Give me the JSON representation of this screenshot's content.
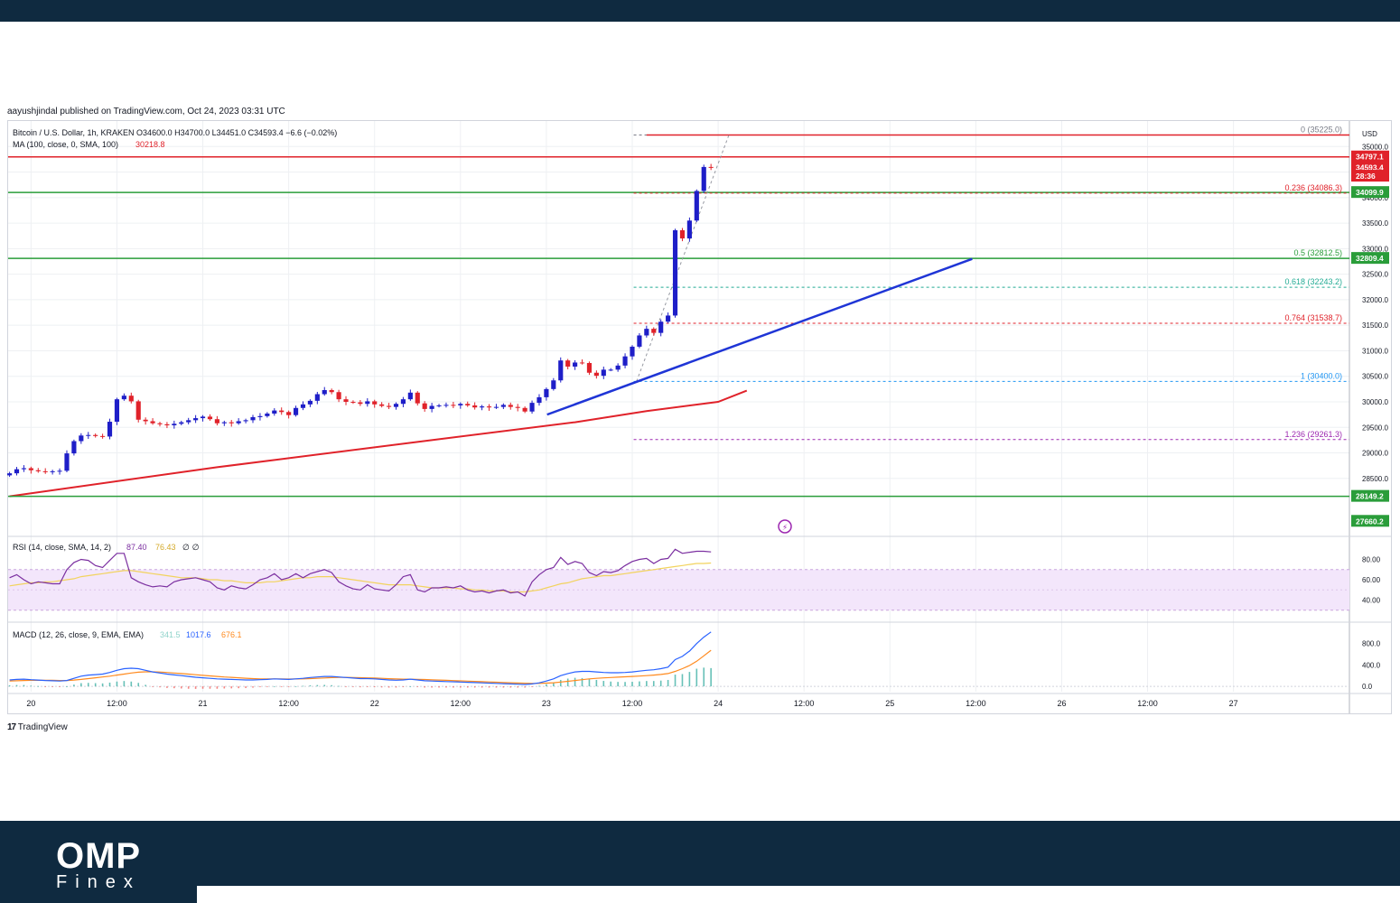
{
  "header": {
    "published": "aayushjindal published on TradingView.com, Oct 24, 2023 03:31 UTC"
  },
  "footer": {
    "brand_main": "OMP",
    "brand_sub": "Finex",
    "tv_brand": "TradingView",
    "tv_logo_mark": "17"
  },
  "legend": {
    "symbol": "Bitcoin / U.S. Dollar, 1h, KRAKEN",
    "ohlc": "O34600.0  H34700.0  L34451.0  C34593.4  −6.6 (−0.02%)",
    "ma_label": "MA (100, close, 0, SMA, 100)",
    "ma_value": "30218.8",
    "rsi_label": "RSI (14, close, SMA, 14, 2)",
    "rsi_value": "87.40",
    "rsi_ma": "76.43",
    "rsi_extra": "∅  ∅",
    "macd_label": "MACD (12, 26, close, 9, EMA, EMA)",
    "macd_hist": "341.5",
    "macd_line": "1017.6",
    "macd_signal": "676.1"
  },
  "colors": {
    "bull": "#1e1ec8",
    "bear": "#e0222a",
    "resistance": "#e0222a",
    "support": "#2a9d3a",
    "trendline": "#1f35d6",
    "ma": "#e0222a",
    "rsi": "#7b2fa0",
    "rsi_ma": "#f2d35e",
    "macd": "#2962ff",
    "signal": "#ff8a1e"
  },
  "chart_data": {
    "type": "candlestick",
    "title": "Bitcoin / U.S. Dollar, 1h, KRAKEN",
    "currency": "USD",
    "ylim": [
      27400,
      35500
    ],
    "y_ticks": [
      {
        "value": 35000,
        "label": "35000.0"
      },
      {
        "value": 34500,
        "label": "34500.0"
      },
      {
        "value": 34000,
        "label": "34000.0"
      },
      {
        "value": 33500,
        "label": "33500.0"
      },
      {
        "value": 33000,
        "label": "33000.0"
      },
      {
        "value": 32500,
        "label": "32500.0"
      },
      {
        "value": 32000,
        "label": "32000.0"
      },
      {
        "value": 31500,
        "label": "31500.0"
      },
      {
        "value": 31000,
        "label": "31000.0"
      },
      {
        "value": 30500,
        "label": "30500.0"
      },
      {
        "value": 30000,
        "label": "30000.0"
      },
      {
        "value": 29500,
        "label": "29500.0"
      },
      {
        "value": 29000,
        "label": "29000.0"
      },
      {
        "value": 28500,
        "label": "28500.0"
      }
    ],
    "x_ticks": [
      {
        "hour": 24,
        "label": "20"
      },
      {
        "hour": 36,
        "label": "12:00"
      },
      {
        "hour": 48,
        "label": "21"
      },
      {
        "hour": 60,
        "label": "12:00"
      },
      {
        "hour": 72,
        "label": "22"
      },
      {
        "hour": 84,
        "label": "12:00"
      },
      {
        "hour": 96,
        "label": "23"
      },
      {
        "hour": 108,
        "label": "12:00"
      },
      {
        "hour": 120,
        "label": "24"
      },
      {
        "hour": 132,
        "label": "12:00"
      },
      {
        "hour": 144,
        "label": "25"
      },
      {
        "hour": 156,
        "label": "12:00"
      },
      {
        "hour": 168,
        "label": "26"
      },
      {
        "hour": 180,
        "label": "12:00"
      },
      {
        "hour": 192,
        "label": "27"
      }
    ],
    "xlim_hours": [
      20.8,
      208.2
    ],
    "closes": [
      28600,
      28680,
      28700,
      28660,
      28640,
      28630,
      28640,
      28650,
      28990,
      29230,
      29340,
      29350,
      29330,
      29320,
      29610,
      30050,
      30120,
      30010,
      29650,
      29620,
      29580,
      29560,
      29540,
      29570,
      29600,
      29640,
      29680,
      29710,
      29660,
      29580,
      29600,
      29580,
      29620,
      29640,
      29700,
      29720,
      29770,
      29830,
      29800,
      29740,
      29880,
      29950,
      30020,
      30150,
      30230,
      30190,
      30050,
      30000,
      29990,
      29960,
      30010,
      29950,
      29920,
      29900,
      29960,
      30050,
      30180,
      29970,
      29860,
      29920,
      29930,
      29940,
      29930,
      29960,
      29930,
      29890,
      29910,
      29890,
      29900,
      29940,
      29900,
      29880,
      29810,
      29980,
      30090,
      30250,
      30420,
      30810,
      30690,
      30770,
      30760,
      30570,
      30510,
      30630,
      30630,
      30710,
      30890,
      31080,
      31300,
      31430,
      31350,
      31570,
      31690,
      33360,
      33200,
      33550,
      34130,
      34600,
      34593.4
    ],
    "first_candle_hour": 21.0,
    "ma100": {
      "start_hour": 21.0,
      "start_value": 28150,
      "points": [
        [
          21,
          28150
        ],
        [
          50,
          28720
        ],
        [
          80,
          29250
        ],
        [
          100,
          29600
        ],
        [
          110,
          29820
        ],
        [
          120,
          30000
        ],
        [
          124,
          30218.8
        ]
      ]
    },
    "fibonacci": [
      {
        "level": "0",
        "price": 35225.0,
        "label": "0 (35225.0)",
        "color": "#787b86"
      },
      {
        "level": "0.236",
        "price": 34086.3,
        "label": "0.236 (34086.3)",
        "color": "#e0222a"
      },
      {
        "level": "0.5",
        "price": 32812.5,
        "label": "0.5 (32812.5)",
        "color": "#2a9d3a"
      },
      {
        "level": "0.618",
        "price": 32243.2,
        "label": "0.618 (32243.2)",
        "color": "#22ab94"
      },
      {
        "level": "0.764",
        "price": 31538.7,
        "label": "0.764 (31538.7)",
        "color": "#e0222a"
      },
      {
        "level": "1",
        "price": 30400.0,
        "label": "1 (30400.0)",
        "color": "#2196f3"
      },
      {
        "level": "1.236",
        "price": 29261.3,
        "label": "1.236 (29261.3)",
        "color": "#9c27b0"
      }
    ],
    "horizontal_lines": [
      {
        "price": 34797.1,
        "label": "34797.1",
        "color": "#e0222a"
      },
      {
        "price": 34099.9,
        "label": "34099.9",
        "color": "#2a9d3a"
      },
      {
        "price": 32809.4,
        "label": "32809.4",
        "color": "#2a9d3a"
      },
      {
        "price": 28149.2,
        "label": "28149.2",
        "color": "#2a9d3a"
      }
    ],
    "price_tags": [
      {
        "price": 34593.4,
        "label": "34593.4",
        "color": "#e0222a"
      },
      {
        "price": 34420,
        "label": "28:36",
        "color": "#e0222a"
      },
      {
        "price": 27660.2,
        "label": "27660.2",
        "color": "#2a9d3a"
      }
    ],
    "trendline": {
      "start": [
        96.1,
        29750
      ],
      "end": [
        155.5,
        32800
      ]
    },
    "rsi": {
      "ylim": [
        20,
        100
      ],
      "ticks": [
        {
          "value": 80,
          "label": "80.00"
        },
        {
          "value": 60,
          "label": "60.00"
        },
        {
          "value": 40,
          "label": "40.00"
        }
      ],
      "band": [
        30,
        70
      ],
      "values": [
        62,
        65,
        60,
        56,
        58,
        57,
        56,
        56,
        70,
        77,
        80,
        79,
        74,
        72,
        79,
        86,
        86,
        62,
        58,
        55,
        53,
        54,
        53,
        58,
        60,
        61,
        62,
        60,
        58,
        52,
        50,
        54,
        52,
        51,
        55,
        60,
        62,
        66,
        60,
        62,
        66,
        62,
        66,
        68,
        70,
        67,
        58,
        54,
        51,
        50,
        55,
        51,
        50,
        49,
        55,
        63,
        65,
        50,
        48,
        52,
        52,
        53,
        52,
        54,
        50,
        48,
        49,
        47,
        49,
        50,
        47,
        48,
        44,
        58,
        65,
        70,
        72,
        82,
        75,
        78,
        76,
        67,
        64,
        68,
        67,
        69,
        74,
        78,
        80,
        81,
        76,
        80,
        81,
        90,
        86,
        87,
        88,
        88,
        87.4
      ],
      "ma_values": [
        54,
        55,
        56,
        57,
        57,
        58,
        58,
        59,
        60,
        61,
        63,
        64,
        65,
        66,
        67,
        68,
        69,
        69,
        68,
        67,
        66,
        65,
        64,
        63,
        62,
        62,
        62,
        61,
        60,
        60,
        59,
        59,
        58,
        57,
        57,
        57,
        58,
        58,
        59,
        60,
        61,
        62,
        62,
        63,
        63,
        63,
        62,
        61,
        60,
        59,
        58,
        57,
        56,
        55,
        55,
        55,
        55,
        54,
        53,
        52,
        52,
        52,
        52,
        51,
        51,
        50,
        50,
        49,
        49,
        49,
        48,
        48,
        48,
        49,
        50,
        52,
        54,
        56,
        57,
        59,
        61,
        62,
        63,
        64,
        64,
        65,
        66,
        67,
        68,
        69,
        70,
        71,
        72,
        73,
        74,
        75,
        76,
        76,
        76.43
      ]
    },
    "macd": {
      "ylim": [
        -100,
        1150
      ],
      "ticks": [
        {
          "value": 800,
          "label": "800.0"
        },
        {
          "value": 400,
          "label": "400.0"
        },
        {
          "value": 0,
          "label": "0.0"
        }
      ],
      "macd": [
        120,
        130,
        135,
        125,
        118,
        110,
        105,
        100,
        110,
        150,
        190,
        210,
        220,
        230,
        260,
        300,
        330,
        340,
        330,
        300,
        270,
        250,
        230,
        215,
        200,
        185,
        170,
        160,
        150,
        140,
        135,
        130,
        125,
        120,
        120,
        125,
        130,
        140,
        135,
        130,
        140,
        150,
        165,
        175,
        185,
        185,
        175,
        165,
        155,
        145,
        145,
        140,
        130,
        120,
        115,
        120,
        135,
        120,
        105,
        100,
        95,
        90,
        85,
        80,
        75,
        70,
        65,
        60,
        55,
        50,
        45,
        40,
        35,
        45,
        65,
        100,
        140,
        200,
        240,
        270,
        280,
        280,
        270,
        260,
        255,
        255,
        260,
        270,
        285,
        300,
        310,
        330,
        360,
        500,
        560,
        660,
        800,
        920,
        1017.6
      ],
      "signal": [
        100,
        105,
        110,
        112,
        113,
        113,
        112,
        110,
        110,
        118,
        130,
        145,
        160,
        175,
        190,
        210,
        230,
        250,
        265,
        272,
        272,
        268,
        260,
        250,
        240,
        230,
        218,
        205,
        195,
        185,
        175,
        168,
        160,
        152,
        145,
        140,
        138,
        138,
        138,
        137,
        138,
        140,
        145,
        150,
        157,
        163,
        167,
        168,
        166,
        162,
        159,
        155,
        150,
        144,
        138,
        135,
        134,
        132,
        128,
        123,
        118,
        113,
        108,
        103,
        98,
        93,
        88,
        83,
        78,
        73,
        68,
        63,
        58,
        55,
        55,
        60,
        68,
        80,
        95,
        110,
        125,
        140,
        150,
        158,
        165,
        172,
        178,
        185,
        192,
        200,
        210,
        222,
        240,
        280,
        330,
        390,
        470,
        570,
        676.1
      ],
      "histogram": [
        20,
        25,
        25,
        13,
        5,
        -3,
        -7,
        -10,
        0,
        32,
        60,
        65,
        60,
        55,
        70,
        90,
        100,
        90,
        65,
        28,
        -2,
        -18,
        -30,
        -35,
        -40,
        -45,
        -48,
        -45,
        -45,
        -45,
        -40,
        -38,
        -35,
        -32,
        -25,
        -15,
        -8,
        2,
        -3,
        -7,
        2,
        10,
        20,
        25,
        28,
        22,
        8,
        -3,
        -11,
        -17,
        -14,
        -15,
        -20,
        -24,
        -23,
        -15,
        1,
        -12,
        -23,
        -23,
        -23,
        -23,
        -23,
        -23,
        -23,
        -23,
        -23,
        -23,
        -23,
        -23,
        -23,
        -23,
        -23,
        -10,
        10,
        40,
        72,
        120,
        145,
        160,
        155,
        140,
        120,
        102,
        90,
        83,
        82,
        85,
        93,
        100,
        100,
        108,
        120,
        220,
        230,
        270,
        330,
        350,
        341.5
      ]
    }
  }
}
